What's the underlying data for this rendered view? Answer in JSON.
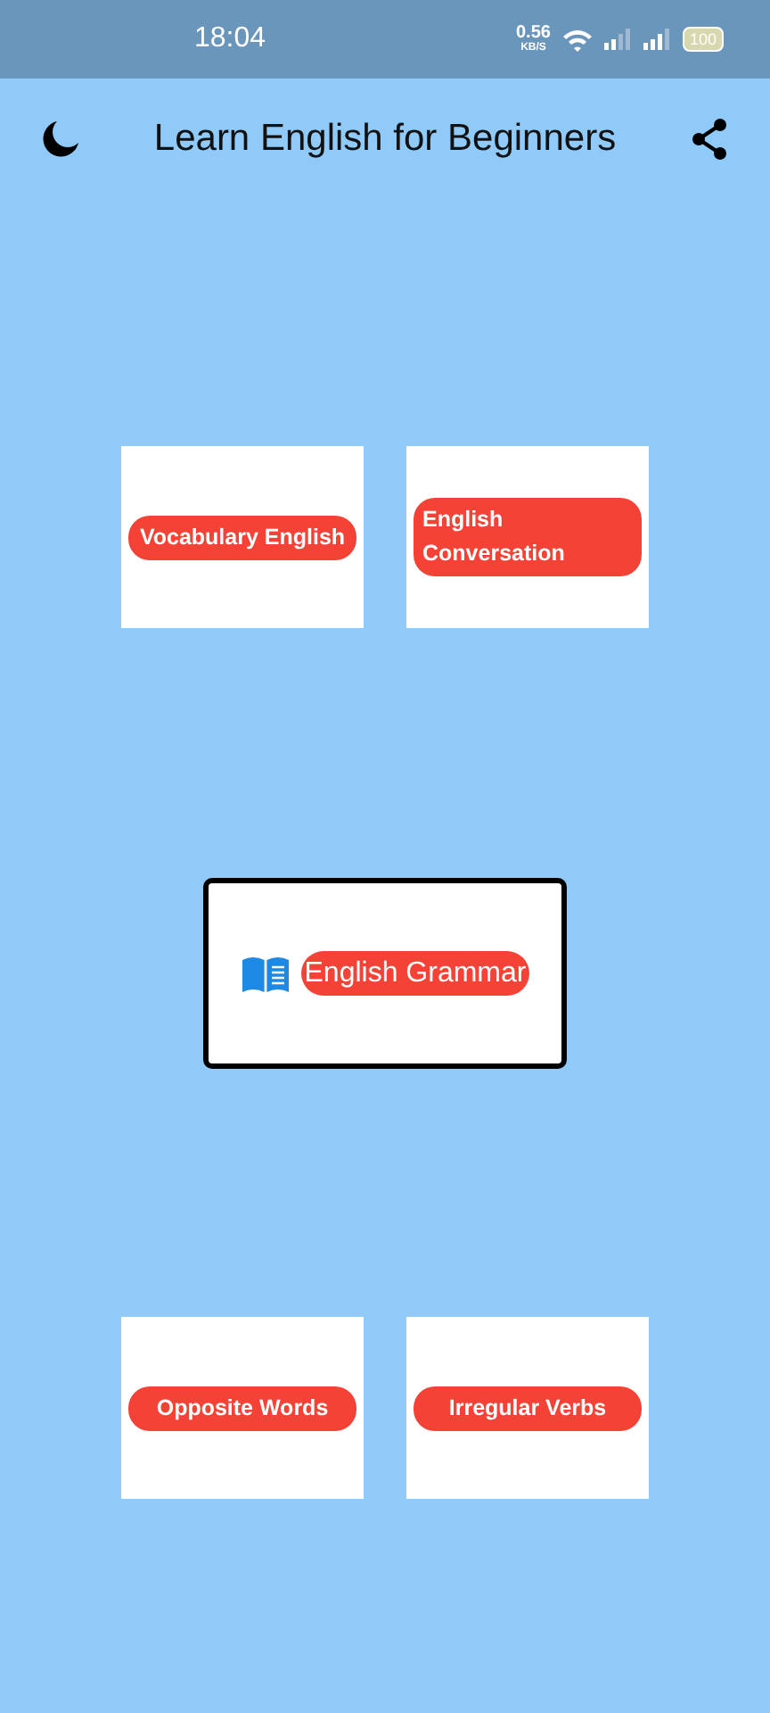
{
  "status_bar": {
    "time": "18:04",
    "speed": "0.56",
    "speed_unit": "KB/S",
    "battery": "100"
  },
  "app_bar": {
    "title": "Learn English for Beginners"
  },
  "top_tiles": [
    {
      "label": "Vocabulary English"
    },
    {
      "label": "English Conversation"
    }
  ],
  "featured": {
    "label": "English Grammar"
  },
  "bottom_tiles": [
    {
      "label": "Opposite Words"
    },
    {
      "label": "Irregular Verbs"
    }
  ]
}
